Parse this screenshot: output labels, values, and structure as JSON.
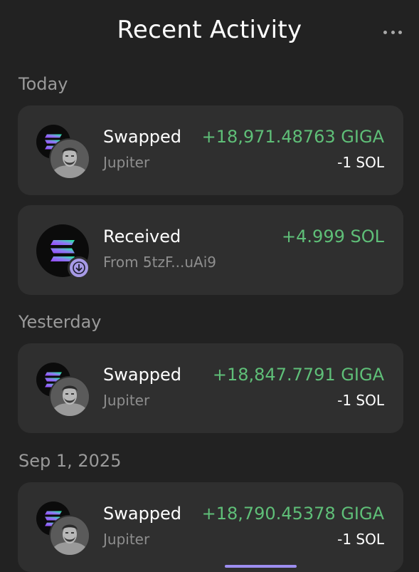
{
  "header": {
    "title": "Recent Activity",
    "menu_icon": "more-horizontal-icon"
  },
  "sections": [
    {
      "label": "Today",
      "items": [
        {
          "type": "swap",
          "title": "Swapped",
          "subtitle": "Jupiter",
          "amount_in": "+18,971.48763 GIGA",
          "amount_out": "-1 SOL",
          "icons": [
            "solana-icon",
            "giga-avatar-icon"
          ]
        },
        {
          "type": "receive",
          "title": "Received",
          "subtitle": "From 5tzF...uAi9",
          "amount_in": "+4.999 SOL",
          "icons": [
            "solana-icon",
            "arrow-down-icon"
          ]
        }
      ]
    },
    {
      "label": "Yesterday",
      "items": [
        {
          "type": "swap",
          "title": "Swapped",
          "subtitle": "Jupiter",
          "amount_in": "+18,847.7791 GIGA",
          "amount_out": "-1 SOL",
          "icons": [
            "solana-icon",
            "giga-avatar-icon"
          ]
        }
      ]
    },
    {
      "label": "Sep 1, 2025",
      "items": [
        {
          "type": "swap",
          "title": "Swapped",
          "subtitle": "Jupiter",
          "amount_in": "+18,790.45378 GIGA",
          "amount_out": "-1 SOL",
          "icons": [
            "solana-icon",
            "giga-avatar-icon"
          ]
        }
      ]
    }
  ],
  "colors": {
    "background": "#222222",
    "card": "#2f2f2f",
    "positive": "#5fbf78",
    "muted": "#8e8e8e",
    "accent": "#a79ae6"
  }
}
